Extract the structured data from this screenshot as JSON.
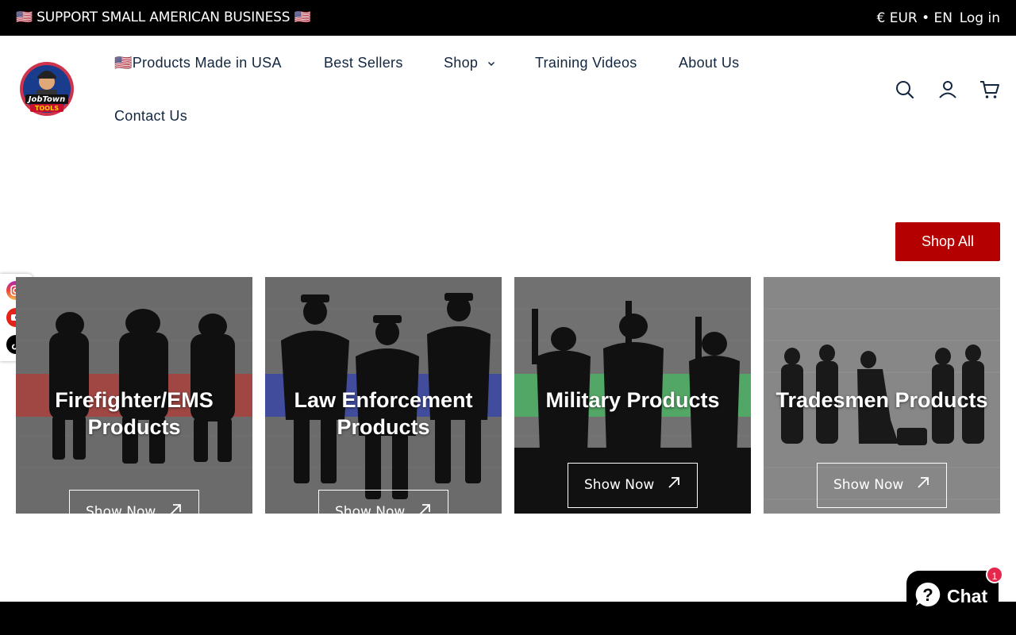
{
  "announcement": {
    "text": "🇺🇸 SUPPORT SMALL AMERICAN BUSINESS 🇺🇸"
  },
  "topbar": {
    "locale": "€ EUR • EN",
    "login": "Log in"
  },
  "brand": {
    "logo_alt": "JobTown Tools",
    "accent_color": "#b40000"
  },
  "nav": {
    "items": [
      {
        "label": "🇺🇸Products Made in USA"
      },
      {
        "label": "Best Sellers"
      },
      {
        "label": "Shop",
        "has_dropdown": true
      },
      {
        "label": "Training Videos"
      },
      {
        "label": "About Us"
      },
      {
        "label": "Contact Us"
      }
    ]
  },
  "header_icons": [
    "search-icon",
    "account-icon",
    "cart-icon"
  ],
  "collection": {
    "shop_all": "Shop All",
    "cards": [
      {
        "title_line1": "Firefighter/EMS",
        "title_line2": "Products",
        "button": "Show Now",
        "stripe_color": "#d9534f"
      },
      {
        "title_line1": "Law Enforcement",
        "title_line2": "Products",
        "button": "Show Now",
        "stripe_color": "#4a5bd4"
      },
      {
        "title_line1": "Military Products",
        "title_line2": "",
        "button": "Show Now",
        "stripe_color": "#5fd77a"
      },
      {
        "title_line1": "Tradesmen Products",
        "title_line2": "",
        "button": "Show Now",
        "stripe_color": ""
      }
    ]
  },
  "social": [
    "instagram-icon",
    "youtube-icon",
    "tiktok-icon"
  ],
  "chat": {
    "label": "Chat",
    "badge": "1"
  }
}
